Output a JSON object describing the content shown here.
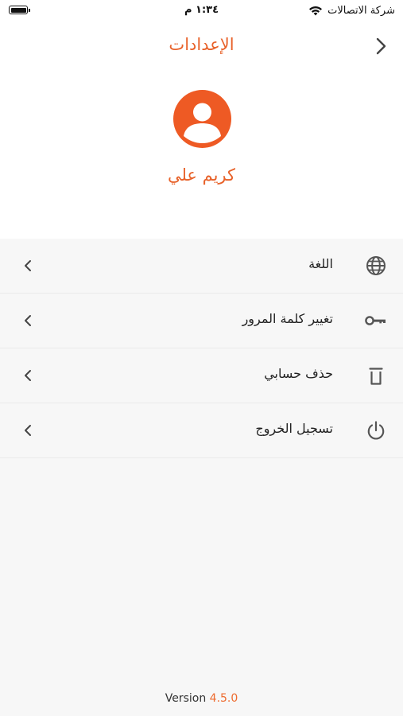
{
  "status_bar": {
    "time": "١:٣٤ م",
    "carrier": "شركة الاتصالات"
  },
  "header": {
    "title": "الإعدادات"
  },
  "profile": {
    "name": "كريم علي"
  },
  "settings": {
    "items": [
      {
        "label": "اللغة",
        "icon": "globe-icon"
      },
      {
        "label": "تغيير كلمة المرور",
        "icon": "key-icon"
      },
      {
        "label": "حذف حسابي",
        "icon": "trash-icon"
      },
      {
        "label": "تسجيل الخروج",
        "icon": "power-icon"
      }
    ]
  },
  "footer": {
    "version_label": "Version",
    "version_number": "4.5.0"
  },
  "colors": {
    "accent": "#e8622a",
    "avatar_bg": "#ee5a24",
    "list_bg": "#f7f7f7",
    "icon_gray": "#555555"
  }
}
